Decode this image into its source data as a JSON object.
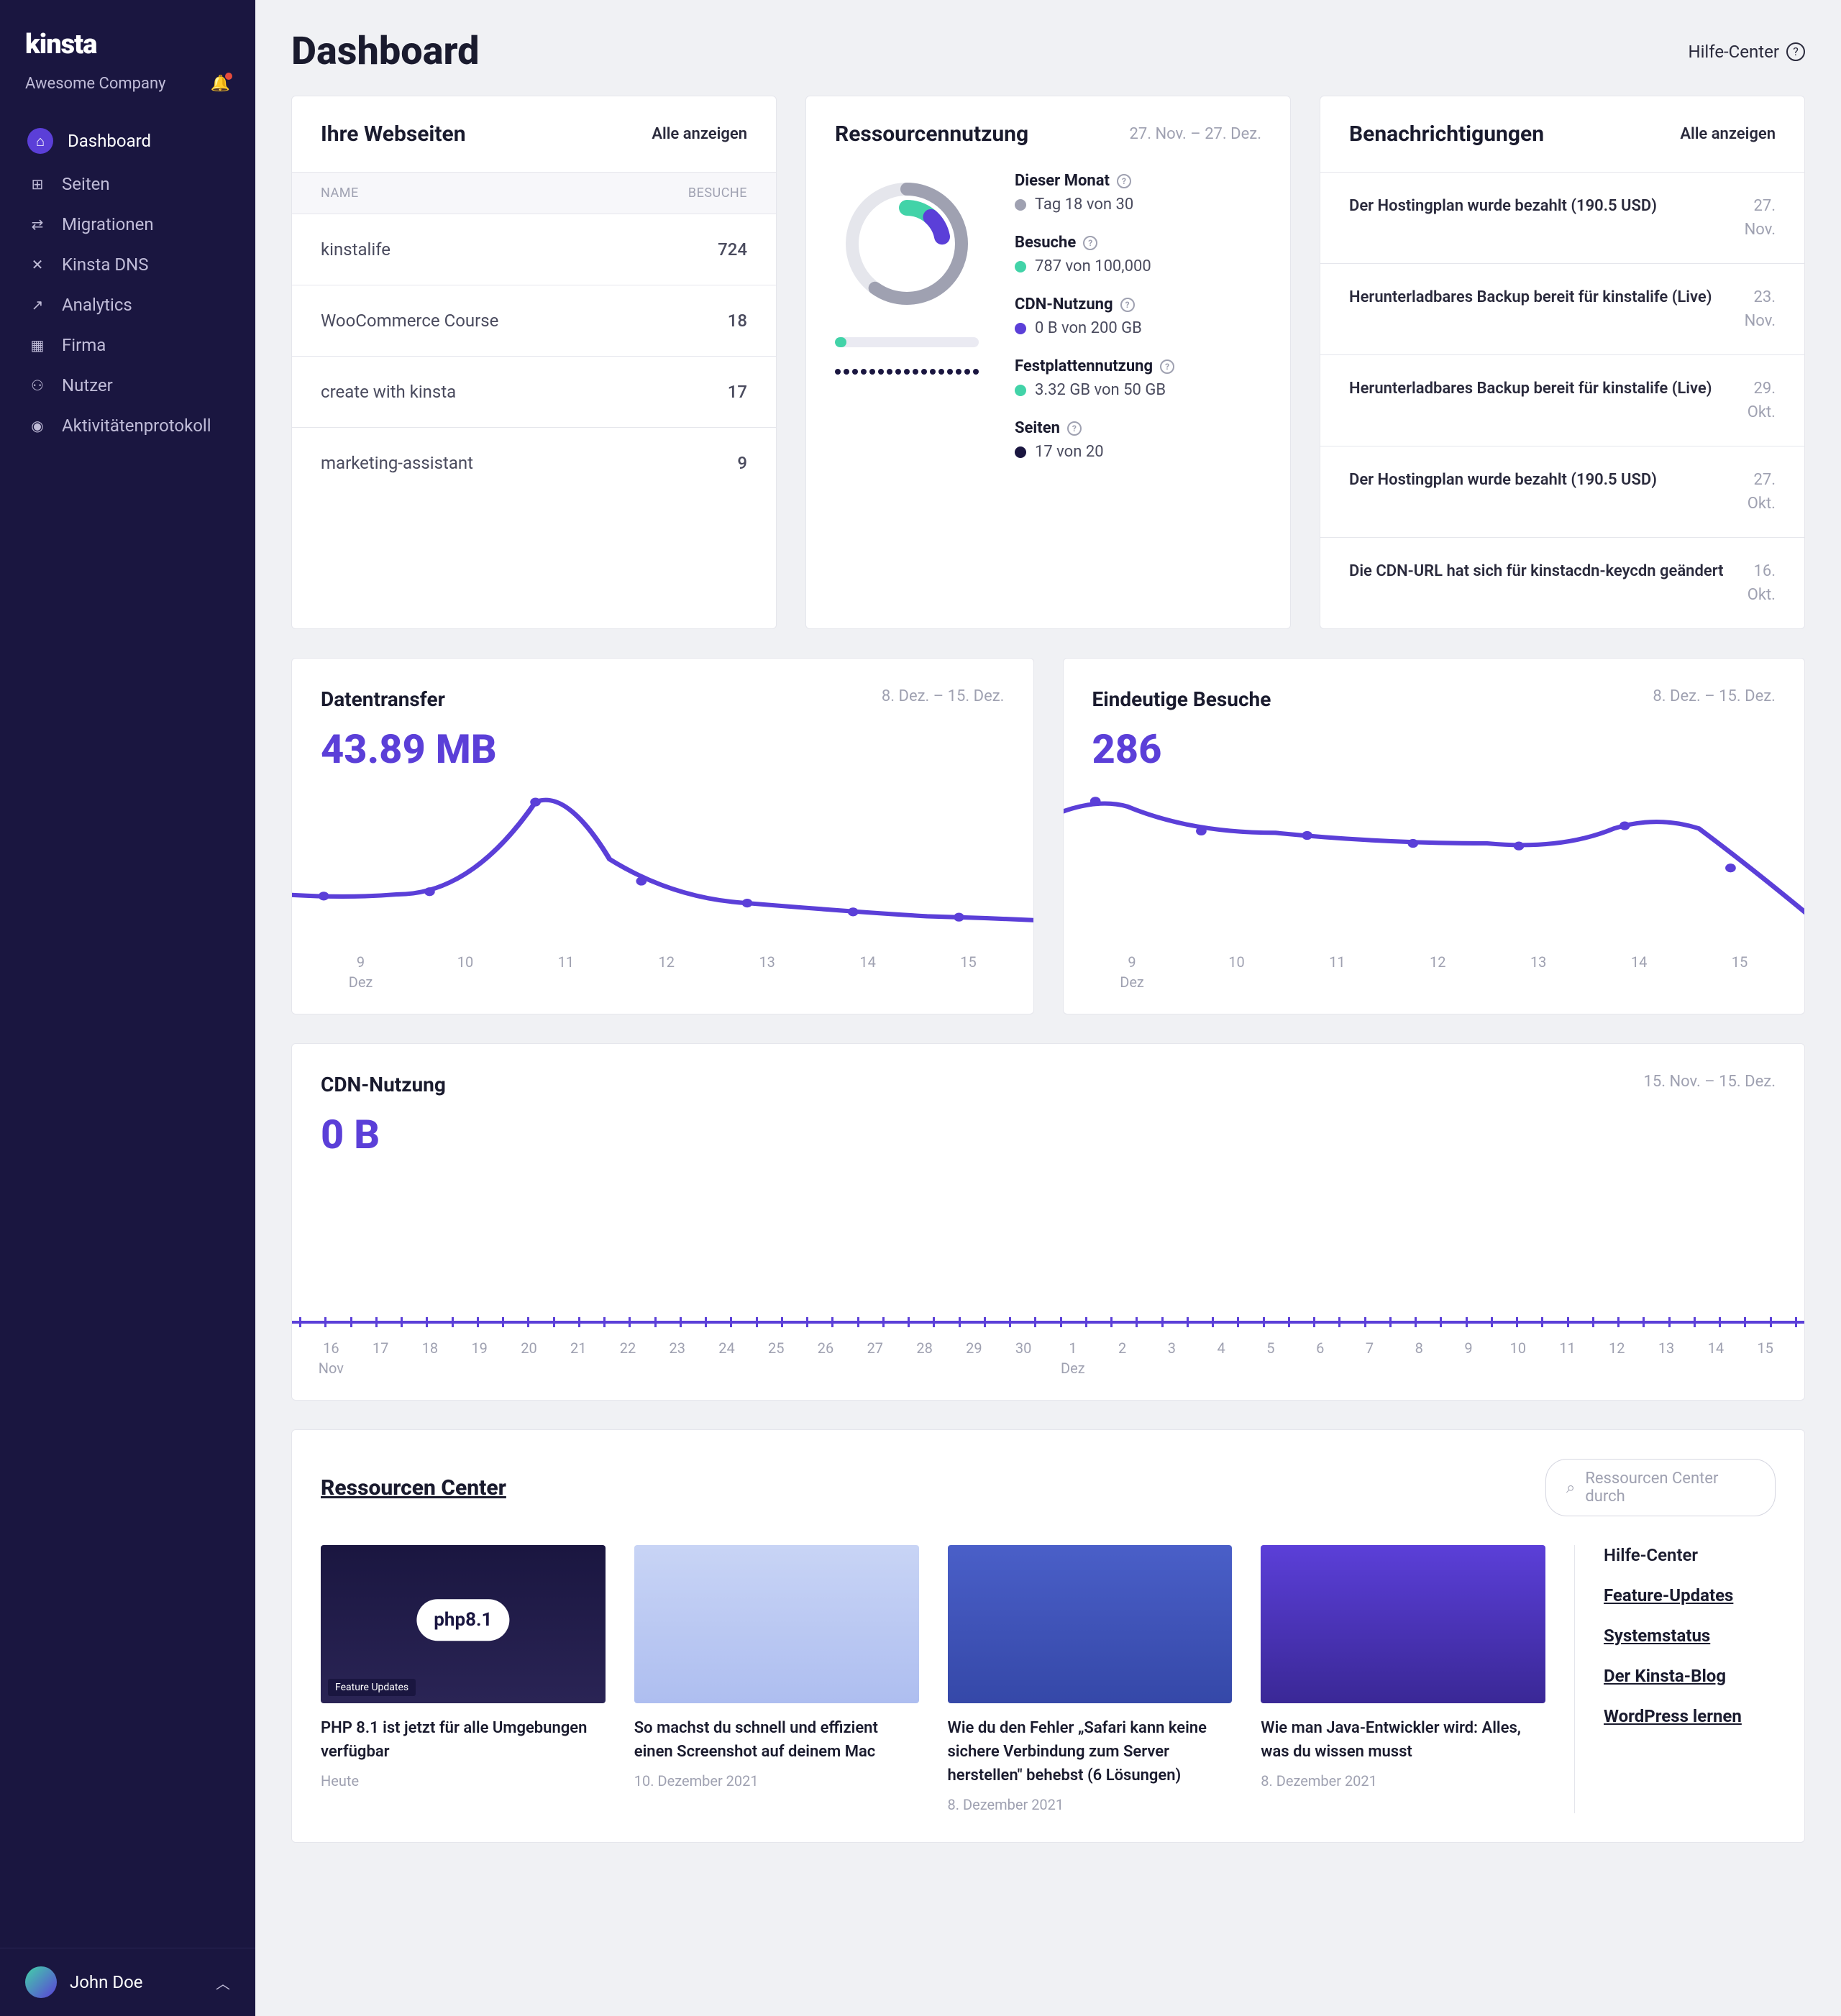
{
  "brand": "kinsta",
  "company": "Awesome Company",
  "nav": {
    "items": [
      {
        "label": "Dashboard",
        "icon": "⌂"
      },
      {
        "label": "Seiten",
        "icon": "⊞"
      },
      {
        "label": "Migrationen",
        "icon": "⇄"
      },
      {
        "label": "Kinsta DNS",
        "icon": "✕"
      },
      {
        "label": "Analytics",
        "icon": "↗"
      },
      {
        "label": "Firma",
        "icon": "▦"
      },
      {
        "label": "Nutzer",
        "icon": "⚇"
      },
      {
        "label": "Aktivitätenprotokoll",
        "icon": "◉"
      }
    ]
  },
  "user": {
    "name": "John Doe"
  },
  "header": {
    "title": "Dashboard",
    "help": "Hilfe-Center"
  },
  "sites": {
    "title": "Ihre Webseiten",
    "all": "Alle anzeigen",
    "col_name": "NAME",
    "col_visits": "BESUCHE",
    "rows": [
      {
        "name": "kinstalife",
        "visits": "724"
      },
      {
        "name": "WooCommerce Course",
        "visits": "18"
      },
      {
        "name": "create with kinsta",
        "visits": "17"
      },
      {
        "name": "marketing-assistant",
        "visits": "9"
      }
    ]
  },
  "usage": {
    "title": "Ressourcennutzung",
    "date": "27. Nov. – 27. Dez.",
    "stats": [
      {
        "label": "Dieser Monat",
        "value": "Tag 18 von 30",
        "bullet": "b-grey"
      },
      {
        "label": "Besuche",
        "value": "787 von 100,000",
        "bullet": "b-teal"
      },
      {
        "label": "CDN-Nutzung",
        "value": "0 B von 200 GB",
        "bullet": "b-purple"
      },
      {
        "label": "Festplattennutzung",
        "value": "3.32 GB von 50 GB",
        "bullet": "b-teal"
      },
      {
        "label": "Seiten",
        "value": "17 von 20",
        "bullet": "b-dark"
      }
    ]
  },
  "notifications": {
    "title": "Benachrichtigungen",
    "all": "Alle anzeigen",
    "items": [
      {
        "text": "Der Hostingplan wurde bezahlt (190.5 USD)",
        "date": "27.\nNov."
      },
      {
        "text": "Herunterladbares Backup bereit für kinstalife (Live)",
        "date": "23.\nNov."
      },
      {
        "text": "Herunterladbares Backup bereit für kinstalife (Live)",
        "date": "29.\nOkt."
      },
      {
        "text": "Der Hostingplan wurde bezahlt (190.5 USD)",
        "date": "27.\nOkt."
      },
      {
        "text": "Die CDN-URL hat sich für kinstacdn-keycdn geändert",
        "date": "16.\nOkt."
      }
    ]
  },
  "transfer": {
    "title": "Datentransfer",
    "date": "8. Dez. – 15. Dez.",
    "value": "43.89 MB"
  },
  "uniques": {
    "title": "Eindeutige Besuche",
    "date": "8. Dez. – 15. Dez.",
    "value": "286"
  },
  "chart_axis": {
    "labels": [
      "9",
      "10",
      "11",
      "12",
      "13",
      "14",
      "15"
    ],
    "month": "Dez"
  },
  "cdn": {
    "title": "CDN-Nutzung",
    "date": "15. Nov. – 15. Dez.",
    "value": "0 B",
    "days": [
      "16",
      "17",
      "18",
      "19",
      "20",
      "21",
      "22",
      "23",
      "24",
      "25",
      "26",
      "27",
      "28",
      "29",
      "30",
      "1",
      "2",
      "3",
      "4",
      "5",
      "6",
      "7",
      "8",
      "9",
      "10",
      "11",
      "12",
      "13",
      "14",
      "15"
    ],
    "m1": "Nov",
    "m2": "Dez"
  },
  "rc": {
    "title": "Ressourcen Center",
    "search_ph": "Ressourcen Center durch",
    "articles": [
      {
        "title": "PHP 8.1 ist jetzt für alle Umgebungen verfügbar",
        "date": "Heute",
        "thumb": "php"
      },
      {
        "title": "So machst du schnell und effizient einen Screenshot auf deinem Mac",
        "date": "10. Dezember 2021",
        "thumb": "2"
      },
      {
        "title": "Wie du den Fehler „Safari kann keine sichere Verbindung zum Server herstellen\" behebst (6 Lösungen)",
        "date": "8. Dezember 2021",
        "thumb": "3"
      },
      {
        "title": "Wie man Java-Entwickler wird: Alles, was du wissen musst",
        "date": "8. Dezember 2021",
        "thumb": "4"
      }
    ],
    "links": [
      "Hilfe-Center",
      "Feature-Updates",
      "Systemstatus",
      "Der Kinsta-Blog",
      "WordPress lernen"
    ],
    "php_label": "php8.1",
    "fu_label": "Feature Updates"
  },
  "chart_data": [
    {
      "type": "line",
      "title": "Datentransfer",
      "x": [
        9,
        10,
        11,
        12,
        13,
        14,
        15
      ],
      "xlabel": "Dez",
      "values": [
        4,
        3,
        14,
        5,
        3,
        2,
        1
      ],
      "unit": "MB",
      "total": "43.89 MB"
    },
    {
      "type": "line",
      "title": "Eindeutige Besuche",
      "x": [
        9,
        10,
        11,
        12,
        13,
        14,
        15
      ],
      "xlabel": "Dez",
      "values": [
        60,
        45,
        42,
        40,
        38,
        42,
        18
      ],
      "total": 286
    },
    {
      "type": "donut",
      "title": "Ressourcennutzung",
      "series": [
        {
          "name": "Tag",
          "value": 18,
          "max": 30
        },
        {
          "name": "Besuche",
          "value": 787,
          "max": 100000
        },
        {
          "name": "CDN",
          "value": 0,
          "max": 200,
          "unit": "GB"
        },
        {
          "name": "Festplatte",
          "value": 3.32,
          "max": 50,
          "unit": "GB"
        },
        {
          "name": "Seiten",
          "value": 17,
          "max": 20
        }
      ]
    },
    {
      "type": "area",
      "title": "CDN-Nutzung",
      "x_start": "16 Nov",
      "x_end": "15 Dez",
      "values_all_zero": true,
      "total": "0 B"
    }
  ]
}
